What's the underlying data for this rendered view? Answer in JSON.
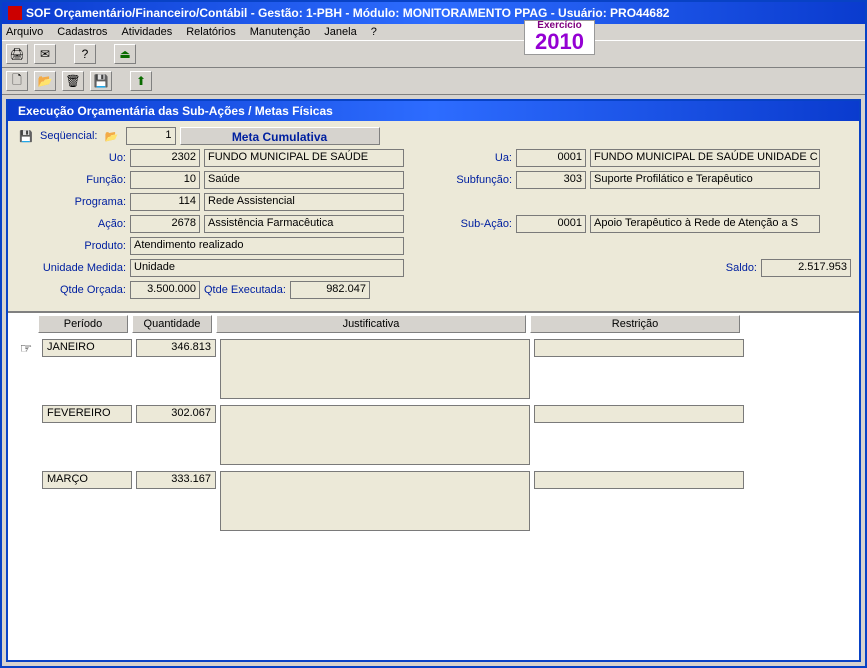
{
  "window": {
    "title": "SOF Orçamentário/Financeiro/Contábil - Gestão: 1-PBH - Módulo: MONITORAMENTO PPAG - Usuário: PRO44682"
  },
  "menu": {
    "items": [
      "Arquivo",
      "Cadastros",
      "Atividades",
      "Relatórios",
      "Manutenção",
      "Janela",
      "?"
    ]
  },
  "exercicio": {
    "label": "Exercício",
    "year": "2010"
  },
  "inner": {
    "title": "Execução Orçamentária das Sub-Ações / Metas Físicas"
  },
  "form": {
    "sequencial_label": "Seqüencial:",
    "sequencial": "1",
    "meta_header": "Meta Cumulativa",
    "uo_label": "Uo:",
    "uo_code": "2302",
    "uo_desc": "FUNDO MUNICIPAL DE SAÚDE",
    "ua_label": "Ua:",
    "ua_code": "0001",
    "ua_desc": "FUNDO MUNICIPAL DE SAÚDE  UNIDADE C",
    "funcao_label": "Função:",
    "funcao_code": "10",
    "funcao_desc": "Saúde",
    "subfuncao_label": "Subfunção:",
    "subfuncao_code": "303",
    "subfuncao_desc": "Suporte Profilático e Terapêutico",
    "programa_label": "Programa:",
    "programa_code": "114",
    "programa_desc": "Rede Assistencial",
    "acao_label": "Ação:",
    "acao_code": "2678",
    "acao_desc": "Assistência Farmacêutica",
    "subacao_label": "Sub-Ação:",
    "subacao_code": "0001",
    "subacao_desc": "Apoio Terapêutico à Rede de Atenção a S",
    "produto_label": "Produto:",
    "produto": "Atendimento realizado",
    "unidade_label": "Unidade Medida:",
    "unidade": "Unidade",
    "saldo_label": "Saldo:",
    "saldo": "2.517.953",
    "qtde_orcada_label": "Qtde Orçada:",
    "qtde_orcada": "3.500.000",
    "qtde_exec_label": "Qtde Executada:",
    "qtde_exec": "982.047"
  },
  "grid": {
    "headers": {
      "periodo": "Período",
      "quantidade": "Quantidade",
      "justificativa": "Justificativa",
      "restricao": "Restrição"
    },
    "rows": [
      {
        "periodo": "JANEIRO",
        "quantidade": "346.813",
        "justificativa": "",
        "restricao": "",
        "current": true
      },
      {
        "periodo": "FEVEREIRO",
        "quantidade": "302.067",
        "justificativa": "",
        "restricao": "",
        "current": false
      },
      {
        "periodo": "MARÇO",
        "quantidade": "333.167",
        "justificativa": "",
        "restricao": "",
        "current": false
      }
    ]
  }
}
